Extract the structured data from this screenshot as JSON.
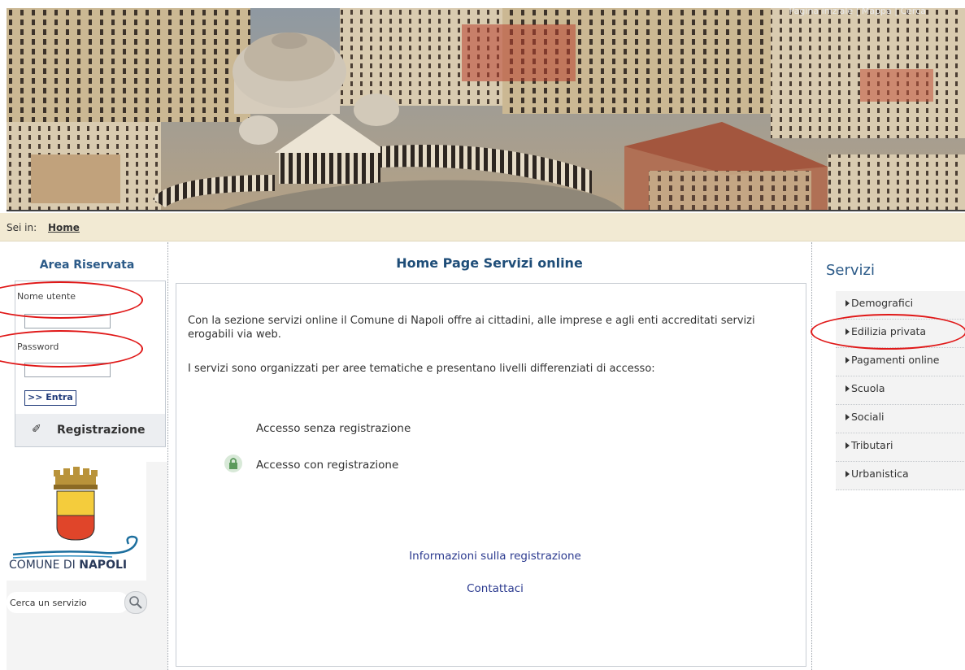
{
  "banner": {
    "caption": "Pagina iniziale | Mappa | Cerca"
  },
  "breadcrumb": {
    "prefix": "Sei in:",
    "home": "Home"
  },
  "login": {
    "title": "Area Riservata",
    "username_label": "Nome utente",
    "username_value": "",
    "password_label": "Password",
    "password_value": "",
    "submit_label": ">> Entra",
    "register_label": "Registrazione"
  },
  "logo": {
    "text_light": "COMUNE DI ",
    "text_bold": "NAPOLI"
  },
  "search": {
    "placeholder": "Cerca un servizio"
  },
  "main": {
    "title": "Home Page Servizi online",
    "intro": "Con la sezione servizi online il Comune di Napoli offre ai cittadini, alle imprese e agli enti accreditati servizi erogabili via web.",
    "levels": "I servizi sono organizzati per aree tematiche e presentano livelli differenziati di accesso:",
    "access_free": "Accesso senza registrazione",
    "access_registered": "Accesso con registrazione",
    "info_link": "Informazioni sulla registrazione",
    "contact_link": "Contattaci"
  },
  "services": {
    "title": "Servizi",
    "items": [
      {
        "label": "Demografici"
      },
      {
        "label": "Edilizia privata"
      },
      {
        "label": "Pagamenti online"
      },
      {
        "label": "Scuola"
      },
      {
        "label": "Sociali"
      },
      {
        "label": "Tributari"
      },
      {
        "label": "Urbanistica"
      }
    ]
  },
  "colors": {
    "breadcrumb_bg": "#f2ead3",
    "title_blue": "#1e4d78",
    "link_blue": "#2b3a8f",
    "annotation_red": "#e01818"
  }
}
